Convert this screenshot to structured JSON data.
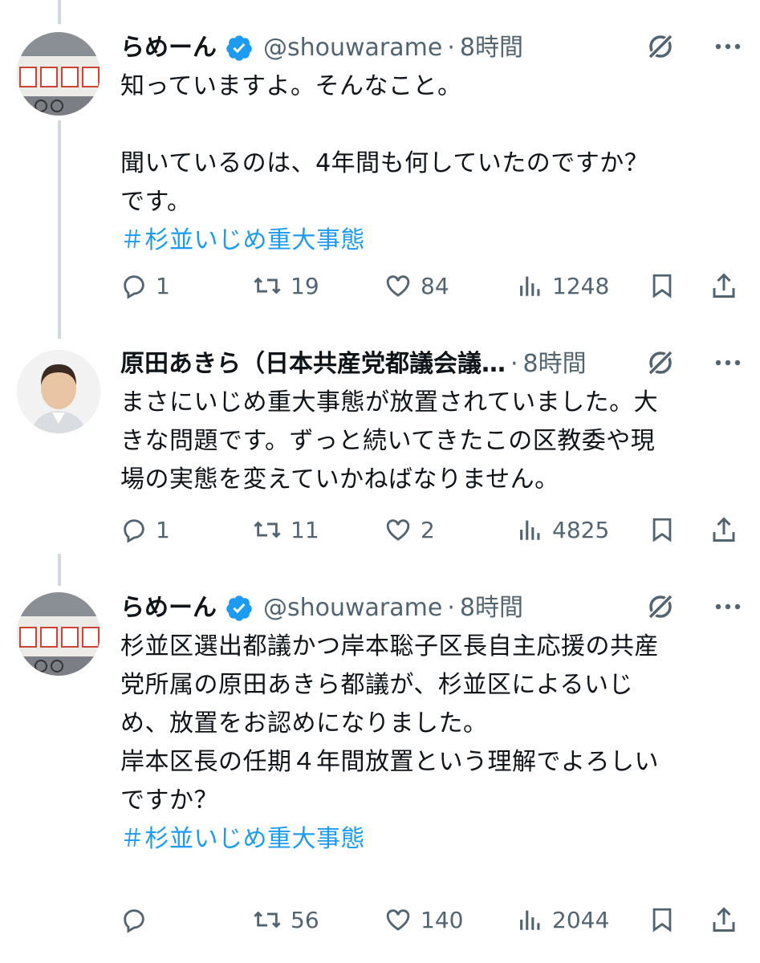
{
  "tweets": [
    {
      "display_name": "らめーん",
      "handle": "@shouwarame",
      "time": "8時間",
      "body": "知っていますよ。そんなこと。\n\n聞いているのは、4年間も何していたのですか？\nです。",
      "hashtag": "＃杉並いじめ重大事態",
      "replies": "1",
      "retweets": "19",
      "likes": "84",
      "views": "1248"
    },
    {
      "display_name": "原田あきら（日本共産党都議会議…",
      "time": "8時間",
      "body": "まさにいじめ重大事態が放置されていました。大\nきな問題です。ずっと続いてきたこの区教委や現\n場の実態を変えていかねばなりません。",
      "replies": "1",
      "retweets": "11",
      "likes": "2",
      "views": "4825"
    },
    {
      "display_name": "らめーん",
      "handle": "@shouwarame",
      "time": "8時間",
      "body": "杉並区選出都議かつ岸本聡子区長自主応援の共産\n党所属の原田あきら都議が、杉並区によるいじ\nめ、放置をお認めになりました。\n岸本区長の任期４年間放置という理解でよろしい\nですか？\n",
      "hashtag": "＃杉並いじめ重大事態",
      "replies": "",
      "retweets": "56",
      "likes": "140",
      "views": "2044"
    }
  ],
  "colors": {
    "accent": "#1d9bf0",
    "text": "#0f1419",
    "muted": "#536471",
    "thread_line": "#cfd9de"
  },
  "icons": {
    "verified": "verified-badge-icon",
    "grok": "grok-icon",
    "more": "more-icon",
    "reply": "reply-icon",
    "retweet": "retweet-icon",
    "like": "like-icon",
    "views": "views-icon",
    "bookmark": "bookmark-icon",
    "share": "share-icon"
  }
}
